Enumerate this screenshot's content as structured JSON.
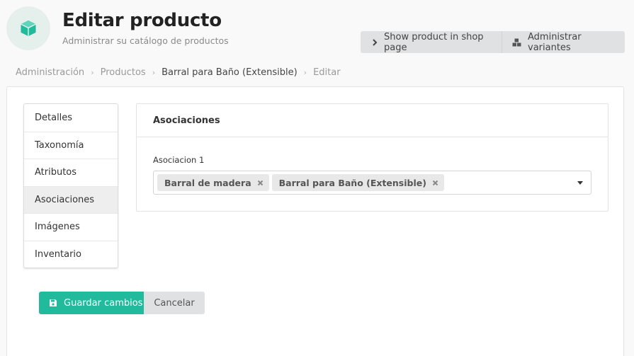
{
  "header": {
    "title": "Editar producto",
    "subtitle": "Administrar su catálogo de productos",
    "icon": "cube-icon",
    "icon_color": "#21ba9c"
  },
  "actions": {
    "show_in_shop": {
      "label": "Show product in shop page",
      "icon": "chevron-right-icon"
    },
    "manage_variants": {
      "label": "Administrar variantes",
      "icon": "cubes-icon"
    }
  },
  "breadcrumb": {
    "items": [
      "Administración",
      "Productos",
      "Barral para Baño (Extensible)",
      "Editar"
    ]
  },
  "sidebar": {
    "items": [
      {
        "label": "Detalles"
      },
      {
        "label": "Taxonomía"
      },
      {
        "label": "Atributos"
      },
      {
        "label": "Asociaciones",
        "active": true
      },
      {
        "label": "Imágenes"
      },
      {
        "label": "Inventario"
      }
    ]
  },
  "associations": {
    "title": "Asociaciones",
    "field_label": "Asociacion 1",
    "selected": [
      "Barral de madera",
      "Barral para Baño (Extensible)"
    ]
  },
  "form": {
    "save_label": "Guardar cambios",
    "cancel_label": "Cancelar",
    "accent_color": "#21ba9c"
  }
}
